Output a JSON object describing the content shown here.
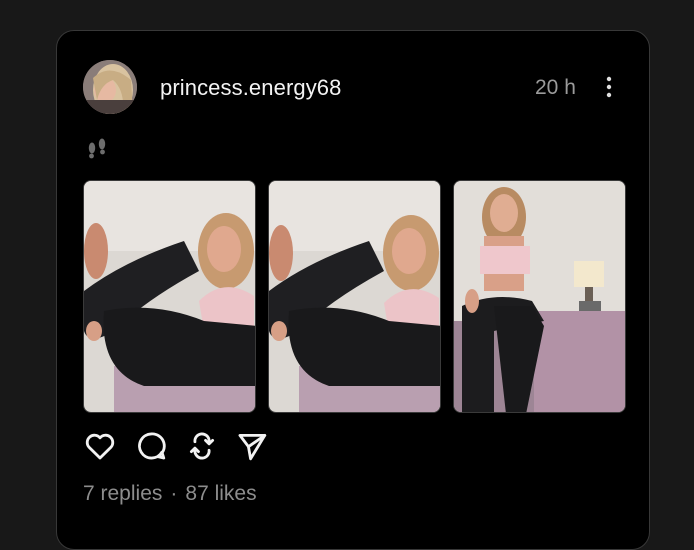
{
  "post": {
    "username": "princess.energy68",
    "time_ago": "20 h",
    "caption_icon": "footprints-icon",
    "images": [
      {
        "name": "post-image-1",
        "description_icon": "photo"
      },
      {
        "name": "post-image-2",
        "description_icon": "photo"
      },
      {
        "name": "post-image-3",
        "description_icon": "photo"
      }
    ],
    "actions": [
      "like-heart-icon",
      "comment-bubble-icon",
      "repost-icon",
      "share-send-icon"
    ],
    "replies_text": "7 replies",
    "separator": "·",
    "likes_text": "87 likes"
  },
  "colors": {
    "page_bg": "#181818",
    "card_bg": "#000000",
    "card_border": "#383838",
    "username": "#f3f3f3",
    "muted": "#9b9b9b"
  }
}
